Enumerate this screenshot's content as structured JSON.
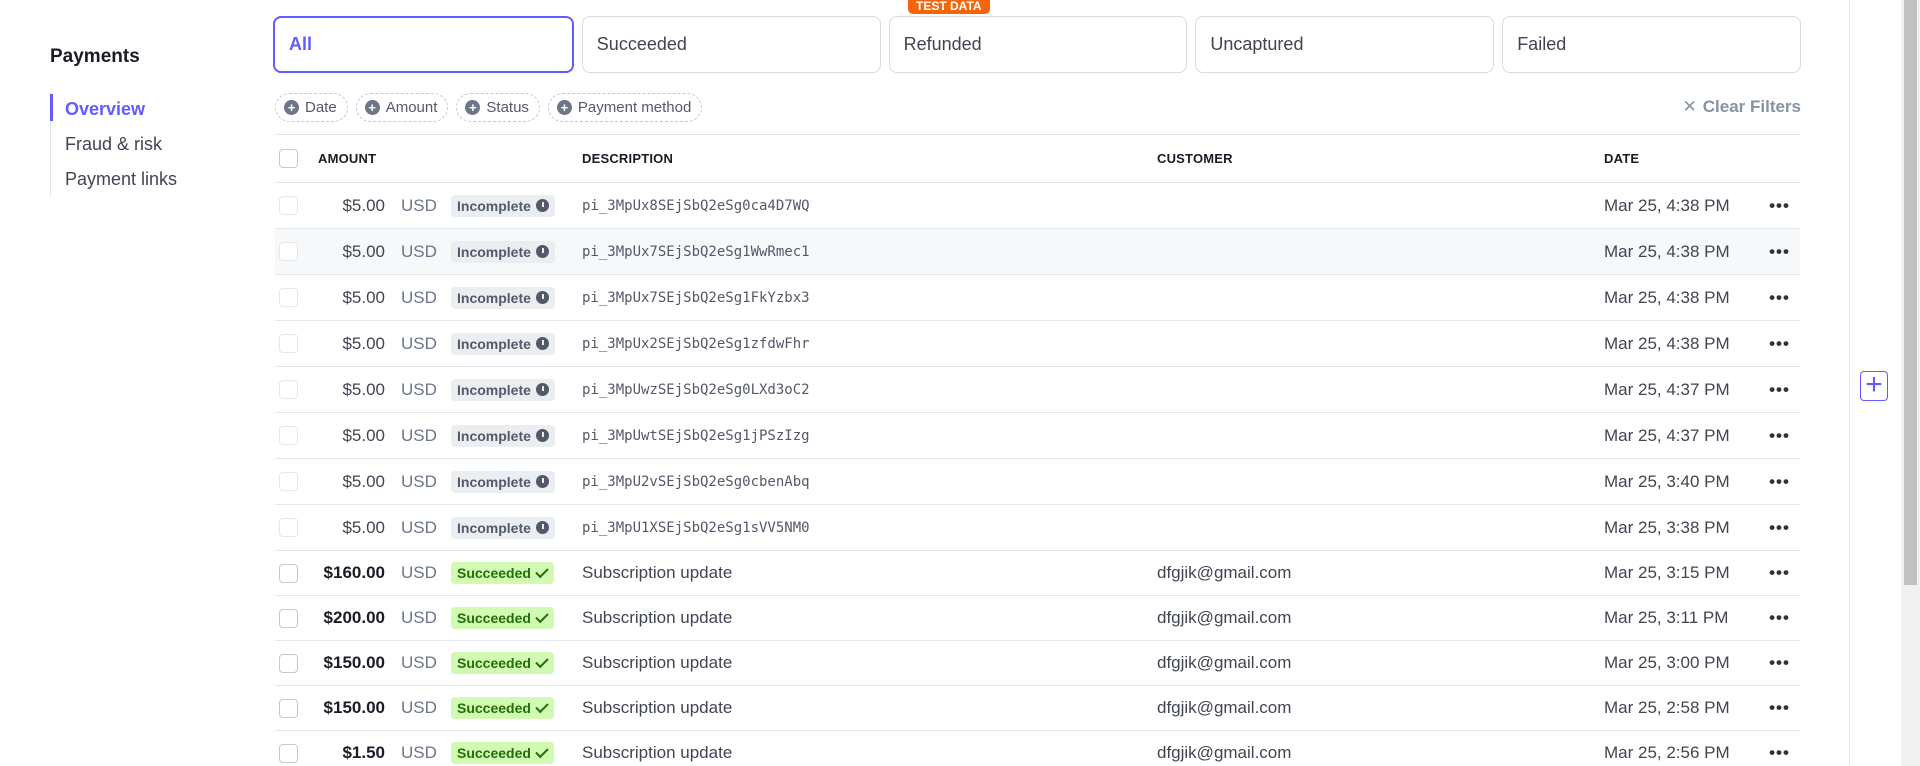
{
  "sidebar": {
    "title": "Payments",
    "items": [
      {
        "label": "Overview"
      },
      {
        "label": "Fraud & risk"
      },
      {
        "label": "Payment links"
      }
    ]
  },
  "tabs": [
    {
      "label": "All"
    },
    {
      "label": "Succeeded"
    },
    {
      "label": "Refunded"
    },
    {
      "label": "Uncaptured"
    },
    {
      "label": "Failed"
    }
  ],
  "test_badge": "TEST DATA",
  "filters": {
    "chips": [
      "Date",
      "Amount",
      "Status",
      "Payment method"
    ],
    "clear_label": "Clear Filters"
  },
  "table": {
    "headers": {
      "amount": "AMOUNT",
      "description": "DESCRIPTION",
      "customer": "CUSTOMER",
      "date": "DATE"
    },
    "rows": [
      {
        "amount": "$5.00",
        "currency": "USD",
        "status": "Incomplete",
        "description": "pi_3MpUx8SEjSbQ2eSg0ca4D7WQ",
        "customer": "",
        "date": "Mar 25, 4:38 PM"
      },
      {
        "amount": "$5.00",
        "currency": "USD",
        "status": "Incomplete",
        "description": "pi_3MpUx7SEjSbQ2eSg1WwRmec1",
        "customer": "",
        "date": "Mar 25, 4:38 PM"
      },
      {
        "amount": "$5.00",
        "currency": "USD",
        "status": "Incomplete",
        "description": "pi_3MpUx7SEjSbQ2eSg1FkYzbx3",
        "customer": "",
        "date": "Mar 25, 4:38 PM"
      },
      {
        "amount": "$5.00",
        "currency": "USD",
        "status": "Incomplete",
        "description": "pi_3MpUx2SEjSbQ2eSg1zfdwFhr",
        "customer": "",
        "date": "Mar 25, 4:38 PM"
      },
      {
        "amount": "$5.00",
        "currency": "USD",
        "status": "Incomplete",
        "description": "pi_3MpUwzSEjSbQ2eSg0LXd3oC2",
        "customer": "",
        "date": "Mar 25, 4:37 PM"
      },
      {
        "amount": "$5.00",
        "currency": "USD",
        "status": "Incomplete",
        "description": "pi_3MpUwtSEjSbQ2eSg1jPSzIzg",
        "customer": "",
        "date": "Mar 25, 4:37 PM"
      },
      {
        "amount": "$5.00",
        "currency": "USD",
        "status": "Incomplete",
        "description": "pi_3MpU2vSEjSbQ2eSg0cbenAbq",
        "customer": "",
        "date": "Mar 25, 3:40 PM"
      },
      {
        "amount": "$5.00",
        "currency": "USD",
        "status": "Incomplete",
        "description": "pi_3MpU1XSEjSbQ2eSg1sVV5NM0",
        "customer": "",
        "date": "Mar 25, 3:38 PM"
      },
      {
        "amount": "$160.00",
        "currency": "USD",
        "status": "Succeeded",
        "description": "Subscription update",
        "customer": "dfgjik@gmail.com",
        "date": "Mar 25, 3:15 PM"
      },
      {
        "amount": "$200.00",
        "currency": "USD",
        "status": "Succeeded",
        "description": "Subscription update",
        "customer": "dfgjik@gmail.com",
        "date": "Mar 25, 3:11 PM"
      },
      {
        "amount": "$150.00",
        "currency": "USD",
        "status": "Succeeded",
        "description": "Subscription update",
        "customer": "dfgjik@gmail.com",
        "date": "Mar 25, 3:00 PM"
      },
      {
        "amount": "$150.00",
        "currency": "USD",
        "status": "Succeeded",
        "description": "Subscription update",
        "customer": "dfgjik@gmail.com",
        "date": "Mar 25, 2:58 PM"
      },
      {
        "amount": "$1.50",
        "currency": "USD",
        "status": "Succeeded",
        "description": "Subscription update",
        "customer": "dfgjik@gmail.com",
        "date": "Mar 25, 2:56 PM"
      }
    ]
  },
  "more_glyph": "•••",
  "colors": {
    "accent": "#635bff",
    "test_badge": "#f5650a",
    "succeeded_bg": "#d1fab3",
    "incomplete_bg": "#ebeef1"
  }
}
